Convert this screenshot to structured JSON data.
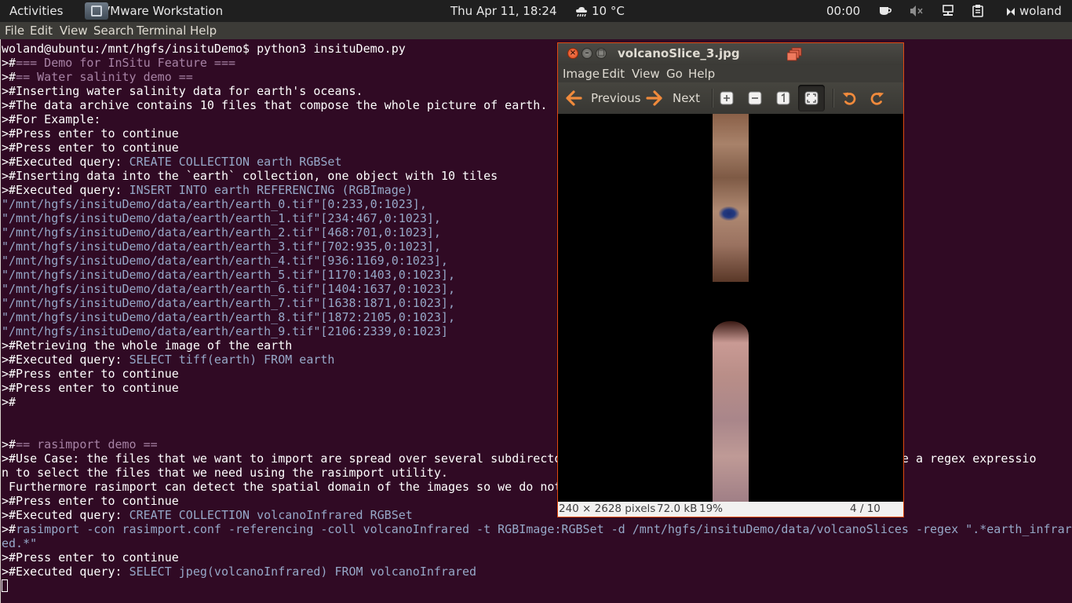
{
  "top_panel": {
    "activities": "Activities",
    "app": "VMware Workstation",
    "clock": "Thu Apr 11, 18:24",
    "weather": "10 °C",
    "timer": "00:00",
    "user": "woland"
  },
  "terminal": {
    "menu": [
      "File",
      "Edit",
      "View",
      "Search",
      "Terminal",
      "Help"
    ],
    "lines": [
      [
        {
          "t": "woland@ubuntu:/mnt/hgfs/insituDemo$ python3 insituDemo.py"
        }
      ],
      [
        {
          "t": ">#"
        },
        {
          "t": "=== Demo for InSitu Feature ===",
          "k": "c"
        }
      ],
      [
        {
          "t": ">#"
        },
        {
          "t": "== Water salinity demo ==",
          "k": "c"
        }
      ],
      [
        {
          "t": ">#Inserting water salinity data for earth's oceans."
        }
      ],
      [
        {
          "t": ">#The data archive contains 10 files that compose the whole picture of earth."
        }
      ],
      [
        {
          "t": ">#For Example:"
        }
      ],
      [
        {
          "t": ">#Press enter to continue"
        }
      ],
      [
        {
          "t": ">#Press enter to continue"
        }
      ],
      [
        {
          "t": ">#Executed query: "
        },
        {
          "t": "CREATE COLLECTION earth RGBSet",
          "k": "q"
        }
      ],
      [
        {
          "t": ">#Inserting data into the `earth` collection, one object with 10 tiles"
        }
      ],
      [
        {
          "t": ">#Executed query: "
        },
        {
          "t": "INSERT INTO earth REFERENCING (RGBImage)",
          "k": "q"
        }
      ],
      [
        {
          "t": "\"/mnt/hgfs/insituDemo/data/earth/earth_0.tif\"[0:233,0:1023],",
          "k": "q"
        }
      ],
      [
        {
          "t": "\"/mnt/hgfs/insituDemo/data/earth/earth_1.tif\"[234:467,0:1023],",
          "k": "q"
        }
      ],
      [
        {
          "t": "\"/mnt/hgfs/insituDemo/data/earth/earth_2.tif\"[468:701,0:1023],",
          "k": "q"
        }
      ],
      [
        {
          "t": "\"/mnt/hgfs/insituDemo/data/earth/earth_3.tif\"[702:935,0:1023],",
          "k": "q"
        }
      ],
      [
        {
          "t": "\"/mnt/hgfs/insituDemo/data/earth/earth_4.tif\"[936:1169,0:1023],",
          "k": "q"
        }
      ],
      [
        {
          "t": "\"/mnt/hgfs/insituDemo/data/earth/earth_5.tif\"[1170:1403,0:1023],",
          "k": "q"
        }
      ],
      [
        {
          "t": "\"/mnt/hgfs/insituDemo/data/earth/earth_6.tif\"[1404:1637,0:1023],",
          "k": "q"
        }
      ],
      [
        {
          "t": "\"/mnt/hgfs/insituDemo/data/earth/earth_7.tif\"[1638:1871,0:1023],",
          "k": "q"
        }
      ],
      [
        {
          "t": "\"/mnt/hgfs/insituDemo/data/earth/earth_8.tif\"[1872:2105,0:1023],",
          "k": "q"
        }
      ],
      [
        {
          "t": "\"/mnt/hgfs/insituDemo/data/earth/earth_9.tif\"[2106:2339,0:1023]",
          "k": "q"
        }
      ],
      [
        {
          "t": ">#Retrieving the whole image of the earth"
        }
      ],
      [
        {
          "t": ">#Executed query: "
        },
        {
          "t": "SELECT tiff(earth) FROM earth",
          "k": "q"
        }
      ],
      [
        {
          "t": ">#Press enter to continue"
        }
      ],
      [
        {
          "t": ">#Press enter to continue"
        }
      ],
      [
        {
          "t": ">#"
        }
      ],
      [],
      [],
      [
        {
          "t": ">#"
        },
        {
          "t": "== rasimport demo ==",
          "k": "c"
        }
      ],
      [
        {
          "t": ">#Use Case: the files that we want to import are spread over several subdirecto                                            n use a regex expressio"
        }
      ],
      [
        {
          "t": "n to select the files that we need using the rasimport utility."
        }
      ],
      [
        {
          "t": " Furthermore rasimport can detect the spatial domain of the images so we do not"
        }
      ],
      [
        {
          "t": ">#Press enter to continue"
        }
      ],
      [
        {
          "t": ">#Executed query: "
        },
        {
          "t": "CREATE COLLECTION volcanoInfrared RGBSet",
          "k": "q"
        }
      ],
      [
        {
          "t": ">#"
        },
        {
          "t": "rasimport -con rasimport.conf -referencing -coll volcanoInfrared -t RGBImage:RGBSet -d /mnt/hgfs/insituDemo/data/volcanoSlices -regex \".*earth_infrar",
          "k": "q"
        }
      ],
      [
        {
          "t": "ed.*\"",
          "k": "q"
        }
      ],
      [
        {
          "t": ">#Press enter to continue"
        }
      ],
      [
        {
          "t": ">#Executed query: "
        },
        {
          "t": "SELECT jpeg(volcanoInfrared) FROM volcanoInfrared",
          "k": "q"
        }
      ],
      [
        {
          "t": "",
          "k": "cursor"
        }
      ]
    ]
  },
  "viewer": {
    "title": "volcanoSlice_3.jpg",
    "menu": [
      "Image",
      "Edit",
      "View",
      "Go",
      "Help"
    ],
    "previous": "Previous",
    "next": "Next",
    "status": {
      "dimensions": "240 × 2628 pixels",
      "size": "72.0 kB",
      "zoom": "19%",
      "position": "4 / 10"
    }
  }
}
